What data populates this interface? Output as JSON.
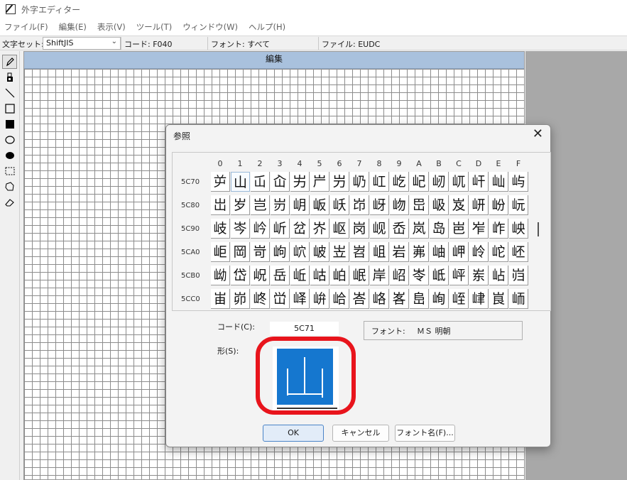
{
  "window": {
    "title": "外字エディター"
  },
  "menu": [
    "ファイル(F)",
    "編集(E)",
    "表示(V)",
    "ツール(T)",
    "ウィンドウ(W)",
    "ヘルプ(H)"
  ],
  "toolbar": {
    "charset_label": "文字セット:",
    "charset_value": "ShiftJIS",
    "code": "コード: F040",
    "font": "フォント: すべて",
    "file": "ファイル: EUDC"
  },
  "tools": [
    "pencil-icon",
    "brush-icon",
    "line-icon",
    "rectangle-icon",
    "filled-rectangle-icon",
    "ellipse-icon",
    "filled-ellipse-icon",
    "rect-select-icon",
    "freeform-select-icon",
    "eraser-icon"
  ],
  "edit": {
    "title": "編集"
  },
  "dialog": {
    "title": "参照",
    "columns": [
      "0",
      "1",
      "2",
      "3",
      "4",
      "5",
      "6",
      "7",
      "8",
      "9",
      "A",
      "B",
      "C",
      "D",
      "E",
      "F"
    ],
    "rows": [
      {
        "code": "5C70",
        "chars": [
          "屰",
          "山",
          "屲",
          "屳",
          "屴",
          "屵",
          "屶",
          "屷",
          "屸",
          "屹",
          "屺",
          "屻",
          "屼",
          "屽",
          "屾",
          "屿"
        ]
      },
      {
        "code": "5C80",
        "chars": [
          "岀",
          "岁",
          "岂",
          "岃",
          "岄",
          "岅",
          "岆",
          "岇",
          "岈",
          "岉",
          "岊",
          "岋",
          "岌",
          "岍",
          "岎",
          "岏"
        ]
      },
      {
        "code": "5C90",
        "chars": [
          "岐",
          "岑",
          "岒",
          "岓",
          "岔",
          "岕",
          "岖",
          "岗",
          "岘",
          "岙",
          "岚",
          "岛",
          "岜",
          "岝",
          "岞",
          "岟"
        ]
      },
      {
        "code": "5CA0",
        "chars": [
          "岠",
          "岡",
          "岢",
          "岣",
          "岤",
          "岥",
          "岦",
          "岧",
          "岨",
          "岩",
          "岪",
          "岫",
          "岬",
          "岭",
          "岮",
          "岯"
        ]
      },
      {
        "code": "5CB0",
        "chars": [
          "岰",
          "岱",
          "岲",
          "岳",
          "岴",
          "岵",
          "岶",
          "岷",
          "岸",
          "岹",
          "岺",
          "岻",
          "岼",
          "岽",
          "岾",
          "岿"
        ]
      },
      {
        "code": "5CC0",
        "chars": [
          "峀",
          "峁",
          "峂",
          "峃",
          "峄",
          "峅",
          "峆",
          "峇",
          "峈",
          "峉",
          "峊",
          "峋",
          "峌",
          "峍",
          "峎",
          "峏"
        ]
      }
    ],
    "selected_row": 0,
    "selected_col": 1,
    "code_label": "コード(C):",
    "code_value": "5C71",
    "font_label": "フォント:",
    "font_value": "ＭＳ 明朝",
    "shape_label": "形(S):",
    "shape_glyph": "山",
    "ok": "OK",
    "cancel": "キャンセル",
    "font_name": "フォント名(F)..."
  }
}
